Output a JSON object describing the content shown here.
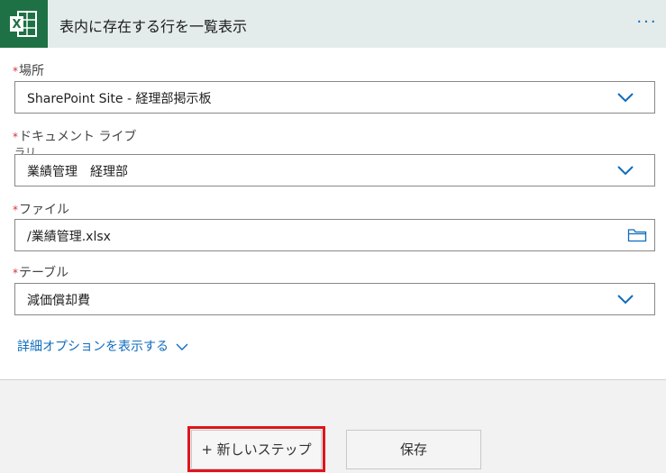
{
  "header": {
    "app_icon": "excel-icon",
    "title": "表内に存在する行を一覧表示",
    "more_icon": "ellipsis-icon"
  },
  "fields": [
    {
      "required": "*",
      "label": "場所",
      "value": "SharePoint Site - 経理部掲示板",
      "control": "dropdown",
      "icon": "chevron-down-icon"
    },
    {
      "required": "*",
      "label": "ドキュメント ライブ",
      "label_cont": "ラリ",
      "value": "業績管理　経理部",
      "control": "dropdown",
      "icon": "chevron-down-icon"
    },
    {
      "required": "*",
      "label": "ファイル",
      "value": "/業績管理.xlsx",
      "control": "file-picker",
      "icon": "folder-icon"
    },
    {
      "required": "*",
      "label": "テーブル",
      "value": "減価償却費",
      "control": "dropdown",
      "icon": "chevron-down-icon"
    }
  ],
  "advanced_options": "詳細オプションを表示する",
  "footer": {
    "new_step": "+ 新しいステップ",
    "save": "保存"
  },
  "colors": {
    "excel_green": "#1e7145",
    "header_bg": "#e3ecea",
    "link_blue": "#0f6cbd",
    "required_red": "#d13438",
    "highlight_red": "#e0141c"
  }
}
